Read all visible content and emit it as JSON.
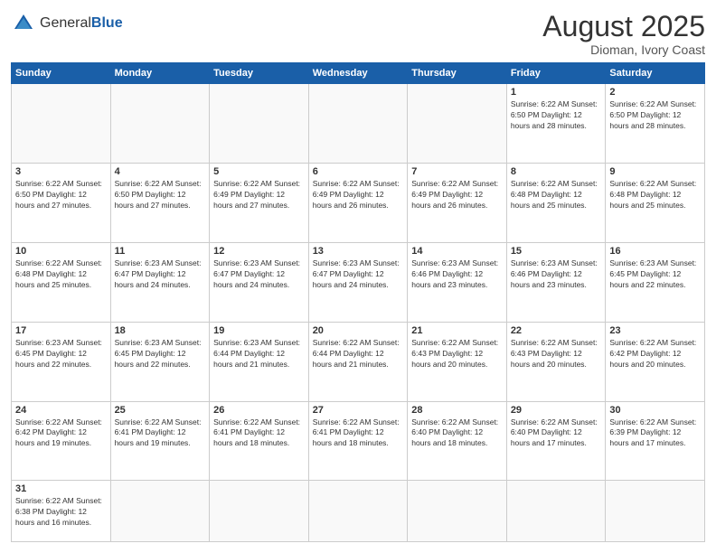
{
  "header": {
    "logo_general": "General",
    "logo_blue": "Blue",
    "month_title": "August 2025",
    "location": "Dioman, Ivory Coast"
  },
  "weekdays": [
    "Sunday",
    "Monday",
    "Tuesday",
    "Wednesday",
    "Thursday",
    "Friday",
    "Saturday"
  ],
  "rows": [
    [
      {
        "day": "",
        "info": ""
      },
      {
        "day": "",
        "info": ""
      },
      {
        "day": "",
        "info": ""
      },
      {
        "day": "",
        "info": ""
      },
      {
        "day": "",
        "info": ""
      },
      {
        "day": "1",
        "info": "Sunrise: 6:22 AM\nSunset: 6:50 PM\nDaylight: 12 hours\nand 28 minutes."
      },
      {
        "day": "2",
        "info": "Sunrise: 6:22 AM\nSunset: 6:50 PM\nDaylight: 12 hours\nand 28 minutes."
      }
    ],
    [
      {
        "day": "3",
        "info": "Sunrise: 6:22 AM\nSunset: 6:50 PM\nDaylight: 12 hours\nand 27 minutes."
      },
      {
        "day": "4",
        "info": "Sunrise: 6:22 AM\nSunset: 6:50 PM\nDaylight: 12 hours\nand 27 minutes."
      },
      {
        "day": "5",
        "info": "Sunrise: 6:22 AM\nSunset: 6:49 PM\nDaylight: 12 hours\nand 27 minutes."
      },
      {
        "day": "6",
        "info": "Sunrise: 6:22 AM\nSunset: 6:49 PM\nDaylight: 12 hours\nand 26 minutes."
      },
      {
        "day": "7",
        "info": "Sunrise: 6:22 AM\nSunset: 6:49 PM\nDaylight: 12 hours\nand 26 minutes."
      },
      {
        "day": "8",
        "info": "Sunrise: 6:22 AM\nSunset: 6:48 PM\nDaylight: 12 hours\nand 25 minutes."
      },
      {
        "day": "9",
        "info": "Sunrise: 6:22 AM\nSunset: 6:48 PM\nDaylight: 12 hours\nand 25 minutes."
      }
    ],
    [
      {
        "day": "10",
        "info": "Sunrise: 6:22 AM\nSunset: 6:48 PM\nDaylight: 12 hours\nand 25 minutes."
      },
      {
        "day": "11",
        "info": "Sunrise: 6:23 AM\nSunset: 6:47 PM\nDaylight: 12 hours\nand 24 minutes."
      },
      {
        "day": "12",
        "info": "Sunrise: 6:23 AM\nSunset: 6:47 PM\nDaylight: 12 hours\nand 24 minutes."
      },
      {
        "day": "13",
        "info": "Sunrise: 6:23 AM\nSunset: 6:47 PM\nDaylight: 12 hours\nand 24 minutes."
      },
      {
        "day": "14",
        "info": "Sunrise: 6:23 AM\nSunset: 6:46 PM\nDaylight: 12 hours\nand 23 minutes."
      },
      {
        "day": "15",
        "info": "Sunrise: 6:23 AM\nSunset: 6:46 PM\nDaylight: 12 hours\nand 23 minutes."
      },
      {
        "day": "16",
        "info": "Sunrise: 6:23 AM\nSunset: 6:45 PM\nDaylight: 12 hours\nand 22 minutes."
      }
    ],
    [
      {
        "day": "17",
        "info": "Sunrise: 6:23 AM\nSunset: 6:45 PM\nDaylight: 12 hours\nand 22 minutes."
      },
      {
        "day": "18",
        "info": "Sunrise: 6:23 AM\nSunset: 6:45 PM\nDaylight: 12 hours\nand 22 minutes."
      },
      {
        "day": "19",
        "info": "Sunrise: 6:23 AM\nSunset: 6:44 PM\nDaylight: 12 hours\nand 21 minutes."
      },
      {
        "day": "20",
        "info": "Sunrise: 6:22 AM\nSunset: 6:44 PM\nDaylight: 12 hours\nand 21 minutes."
      },
      {
        "day": "21",
        "info": "Sunrise: 6:22 AM\nSunset: 6:43 PM\nDaylight: 12 hours\nand 20 minutes."
      },
      {
        "day": "22",
        "info": "Sunrise: 6:22 AM\nSunset: 6:43 PM\nDaylight: 12 hours\nand 20 minutes."
      },
      {
        "day": "23",
        "info": "Sunrise: 6:22 AM\nSunset: 6:42 PM\nDaylight: 12 hours\nand 20 minutes."
      }
    ],
    [
      {
        "day": "24",
        "info": "Sunrise: 6:22 AM\nSunset: 6:42 PM\nDaylight: 12 hours\nand 19 minutes."
      },
      {
        "day": "25",
        "info": "Sunrise: 6:22 AM\nSunset: 6:41 PM\nDaylight: 12 hours\nand 19 minutes."
      },
      {
        "day": "26",
        "info": "Sunrise: 6:22 AM\nSunset: 6:41 PM\nDaylight: 12 hours\nand 18 minutes."
      },
      {
        "day": "27",
        "info": "Sunrise: 6:22 AM\nSunset: 6:41 PM\nDaylight: 12 hours\nand 18 minutes."
      },
      {
        "day": "28",
        "info": "Sunrise: 6:22 AM\nSunset: 6:40 PM\nDaylight: 12 hours\nand 18 minutes."
      },
      {
        "day": "29",
        "info": "Sunrise: 6:22 AM\nSunset: 6:40 PM\nDaylight: 12 hours\nand 17 minutes."
      },
      {
        "day": "30",
        "info": "Sunrise: 6:22 AM\nSunset: 6:39 PM\nDaylight: 12 hours\nand 17 minutes."
      }
    ],
    [
      {
        "day": "31",
        "info": "Sunrise: 6:22 AM\nSunset: 6:38 PM\nDaylight: 12 hours\nand 16 minutes."
      },
      {
        "day": "",
        "info": ""
      },
      {
        "day": "",
        "info": ""
      },
      {
        "day": "",
        "info": ""
      },
      {
        "day": "",
        "info": ""
      },
      {
        "day": "",
        "info": ""
      },
      {
        "day": "",
        "info": ""
      }
    ]
  ]
}
